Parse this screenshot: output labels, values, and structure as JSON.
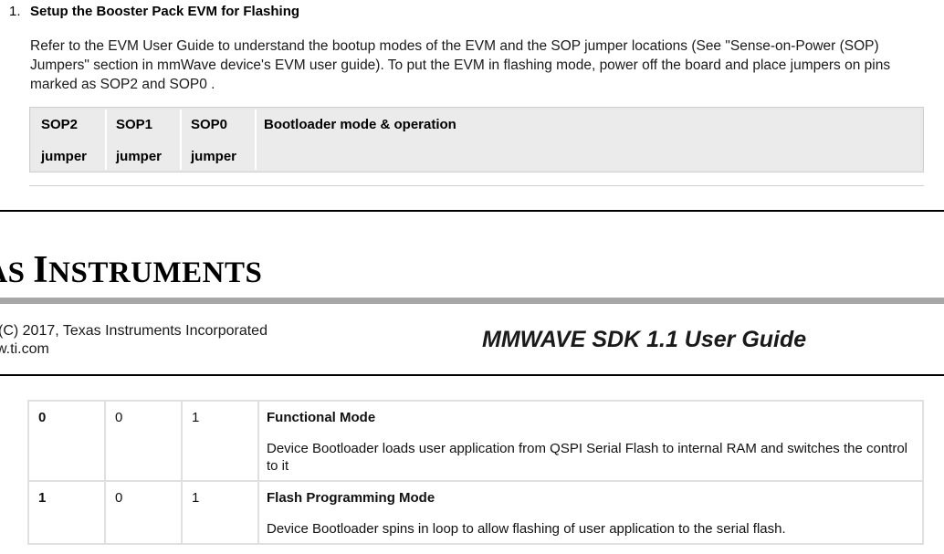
{
  "step": {
    "number": "1.",
    "title": "Setup the Booster Pack EVM for Flashing",
    "intro": "Refer to the EVM User Guide to understand the bootup modes of the EVM and the SOP jumper locations (See \"Sense-on-Power (SOP) Jumpers\" section in mmWave device's EVM user guide). To put the EVM in flashing mode, power off the board and place jumpers on pins marked as SOP2 and SOP0 ."
  },
  "table_header": {
    "sop2_line1": "SOP2",
    "sop2_line2": "jumper",
    "sop1_line1": "SOP1",
    "sop1_line2": "jumper",
    "sop0_line1": "SOP0",
    "sop0_line2": "jumper",
    "mode": "Bootloader mode & operation"
  },
  "footer": {
    "logo_part1": "XAS ",
    "logo_part2": "I",
    "logo_part3": "NSTRUMENTS",
    "copyright": "(C) 2017, Texas Instruments Incorporated",
    "website": "w.ti.com",
    "guide_title": "MMWAVE SDK 1.1 User Guide"
  },
  "table_rows": [
    {
      "sop2": "0",
      "sop1": "0",
      "sop0": "1",
      "mode_title": "Functional Mode",
      "mode_desc": "Device Bootloader loads user application from QSPI Serial Flash to internal RAM and switches the control to it"
    },
    {
      "sop2": "1",
      "sop1": "0",
      "sop0": "1",
      "mode_title": "Flash Programming Mode",
      "mode_desc": "Device Bootloader spins in loop to allow flashing of user application to the serial flash."
    }
  ]
}
